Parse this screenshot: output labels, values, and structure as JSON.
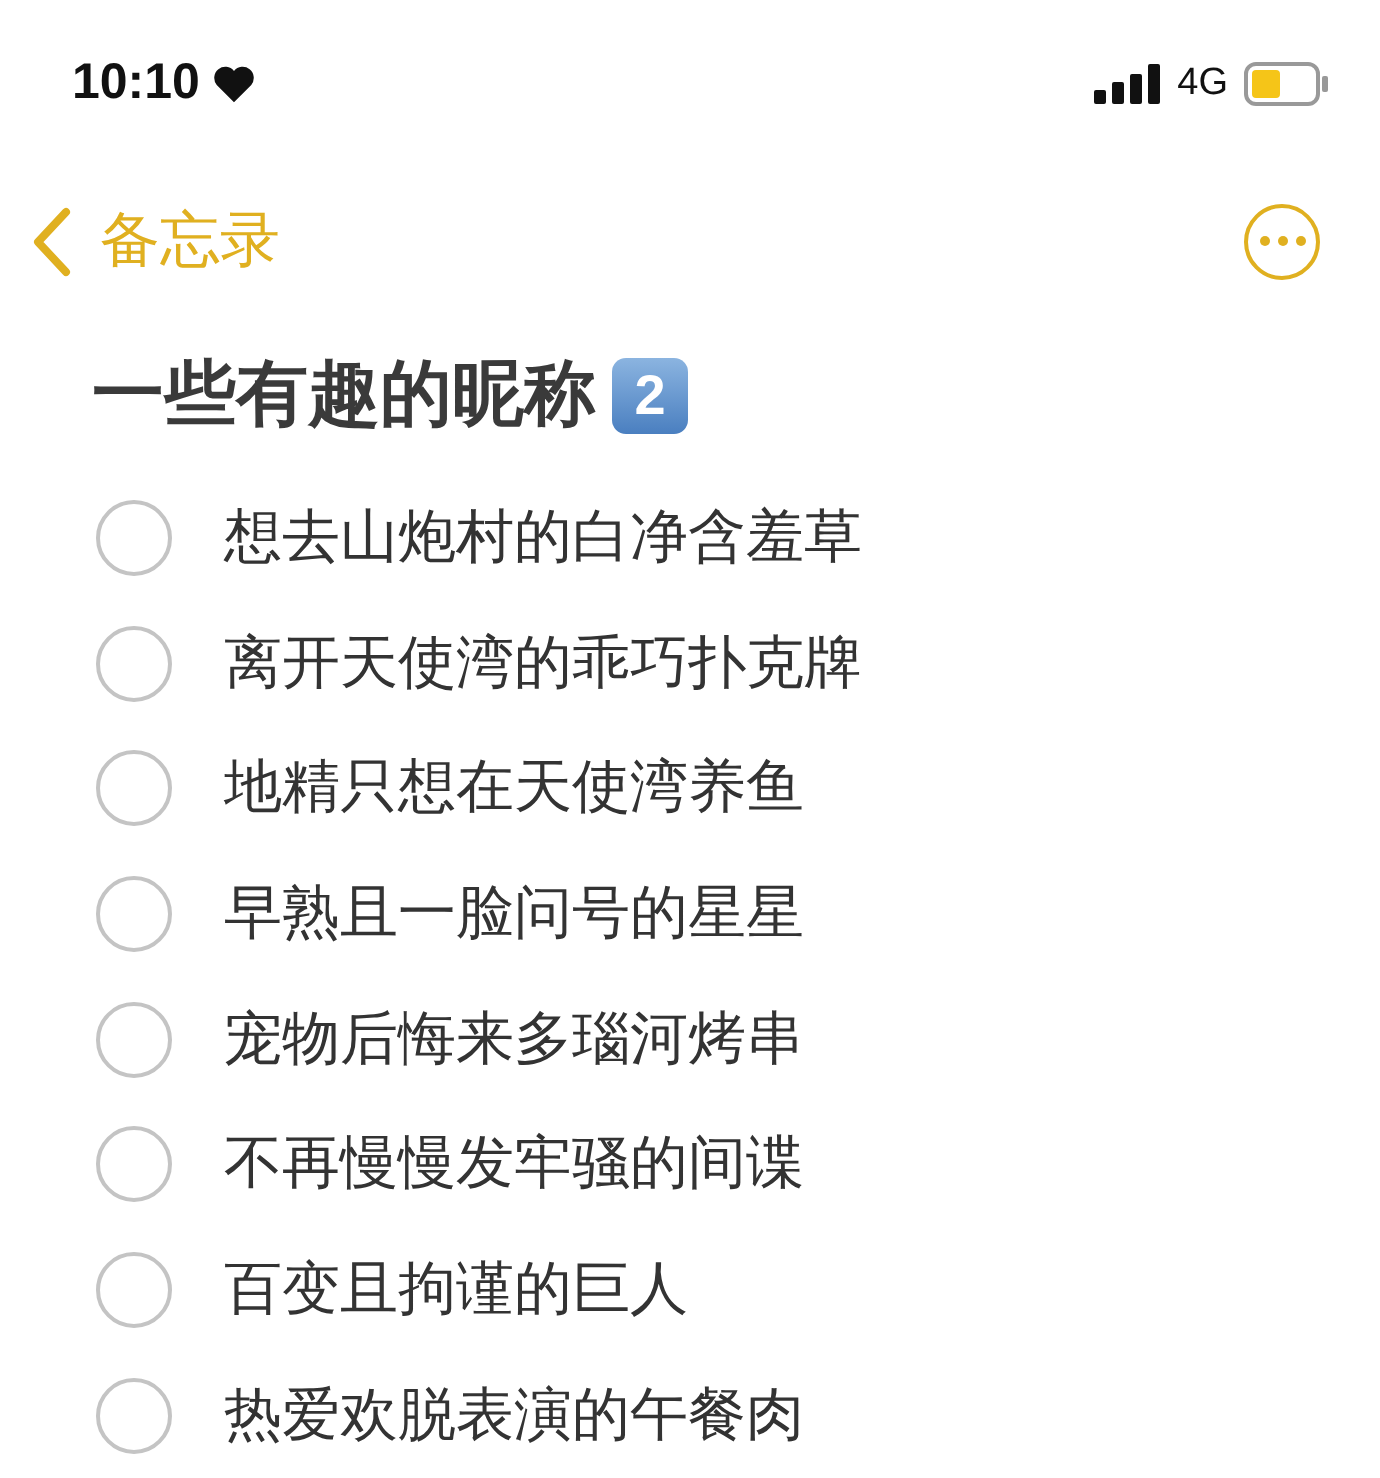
{
  "status_bar": {
    "time": "10:10",
    "network": "4G"
  },
  "nav": {
    "back_label": "备忘录"
  },
  "note": {
    "title": "一些有趣的昵称",
    "title_badge": "2",
    "checklist": [
      {
        "text": "想去山炮村的白净含羞草",
        "checked": false
      },
      {
        "text": "离开天使湾的乖巧扑克牌",
        "checked": false
      },
      {
        "text": "地精只想在天使湾养鱼",
        "checked": false
      },
      {
        "text": "早熟且一脸问号的星星",
        "checked": false
      },
      {
        "text": "宠物后悔来多瑙河烤串",
        "checked": false
      },
      {
        "text": "不再慢慢发牢骚的间谍",
        "checked": false
      },
      {
        "text": "百变且拘谨的巨人",
        "checked": false
      },
      {
        "text": "热爱欢脱表演的午餐肉",
        "checked": false
      }
    ]
  }
}
